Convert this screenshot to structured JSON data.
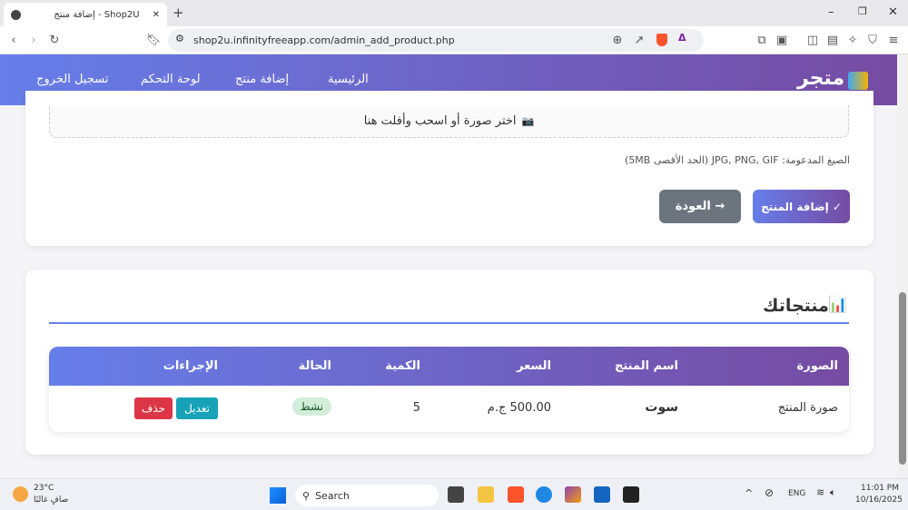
{
  "browser": {
    "tab_title": "إضافة منتج - Shop2U",
    "url": "shop2u.infinityfreeapp.com/admin_add_product.php",
    "new_tab": "+"
  },
  "nav": {
    "logo": "متجر",
    "links": [
      "الرئيسية",
      "إضافة منتج",
      "لوحة التحكم",
      "تسجيل الخروج"
    ]
  },
  "form": {
    "upload_text": "اختر صورة أو اسحب وأفلت هنا",
    "upload_icon": "📷",
    "formats_hint": "الصيغ المدعومة: JPG, PNG, GIF (الحد الأقصى 5MB)",
    "submit_label": "✓ إضافة المنتج",
    "back_label": "→ العودة"
  },
  "products": {
    "title": "منتجاتك",
    "title_icon": "📊",
    "headers": [
      "الصورة",
      "اسم المنتج",
      "السعر",
      "الكمية",
      "الحالة",
      "الإجراءات"
    ],
    "rows": [
      {
        "image_alt": "صورة المنتج",
        "name": "سوت",
        "price": "500.00 ج.م",
        "quantity": "5",
        "status": "نشط",
        "edit": "تعديل",
        "delete": "حذف"
      }
    ]
  },
  "taskbar": {
    "temp": "23°C",
    "weather": "صافٍ غالبًا",
    "search": "Search",
    "lang": "ENG",
    "time": "11:01 PM",
    "date": "10/16/2025"
  },
  "colors": {
    "gradient_start": "#667eea",
    "gradient_end": "#764ba2",
    "back": "#6c757d",
    "edit": "#17a2b8",
    "delete": "#dc3545",
    "status_bg": "#d4edda",
    "status_fg": "#155724"
  }
}
